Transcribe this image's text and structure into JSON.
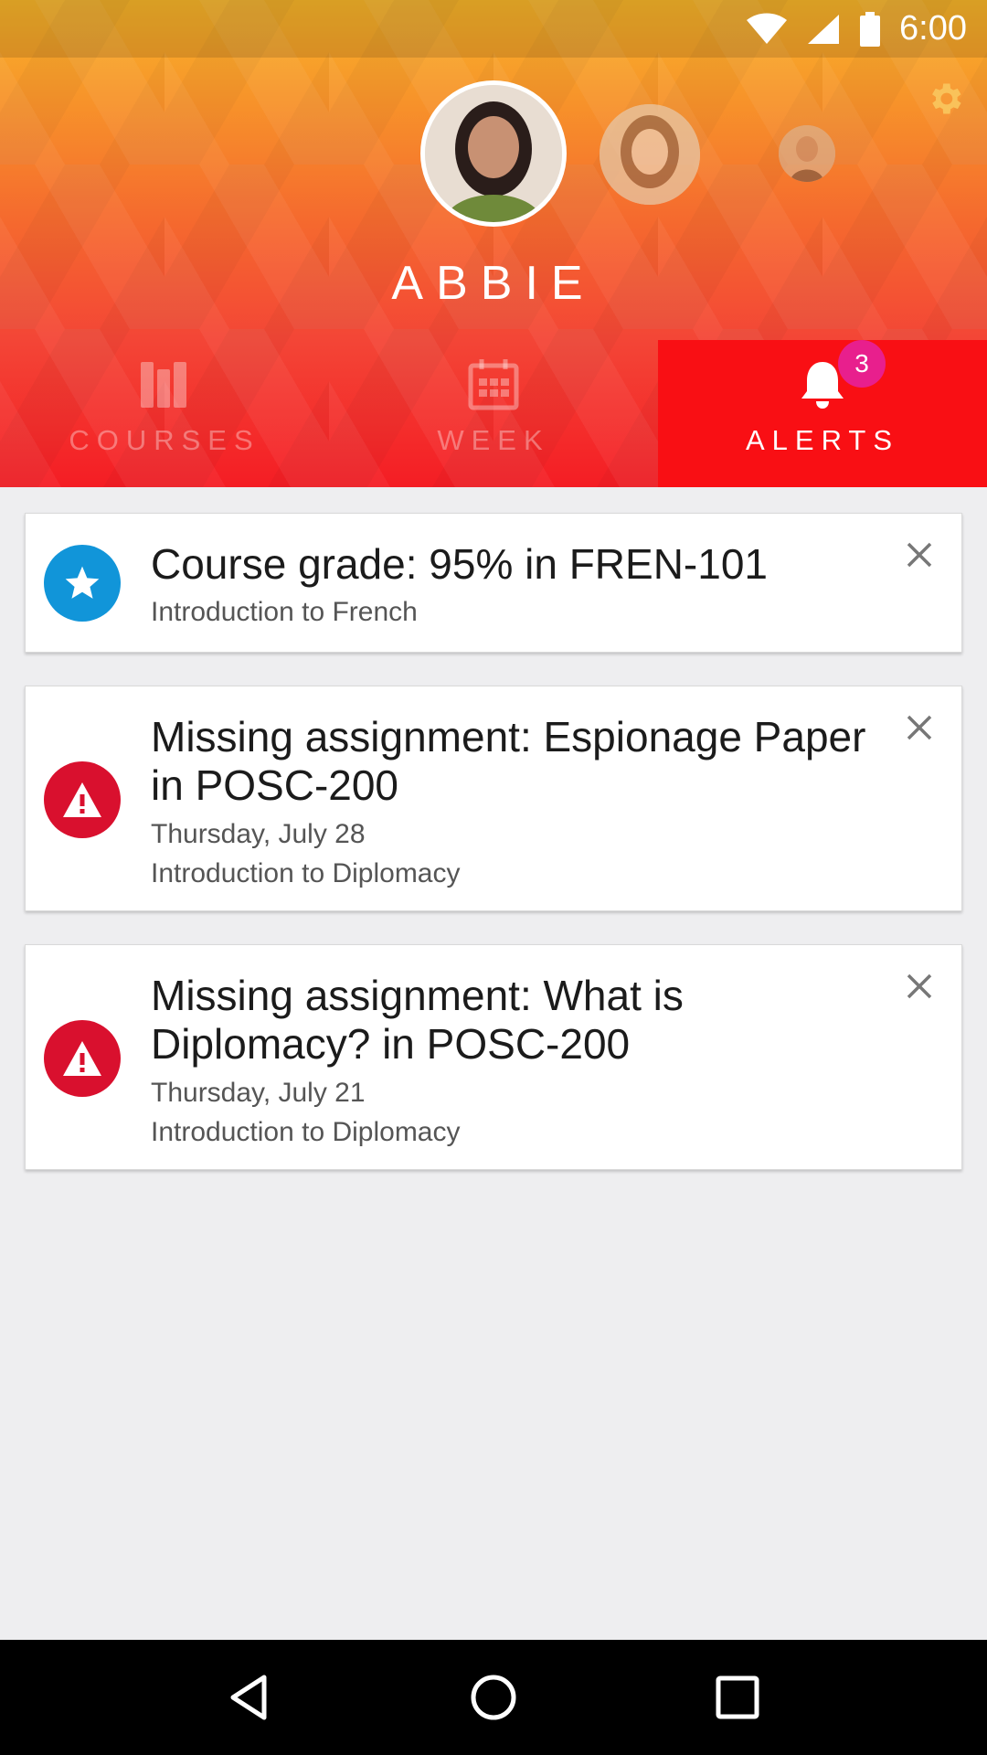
{
  "status_bar": {
    "time": "6:00"
  },
  "profile": {
    "name": "ABBIE"
  },
  "tabs": [
    {
      "label": "COURSES",
      "icon": "courses-icon",
      "active": false
    },
    {
      "label": "WEEK",
      "icon": "calendar-icon",
      "active": false
    },
    {
      "label": "ALERTS",
      "icon": "bell-icon",
      "active": true,
      "badge": "3"
    }
  ],
  "alerts": [
    {
      "icon": "star-icon",
      "title": "Course grade: 95% in FREN-101",
      "subtitle": "Introduction to French"
    },
    {
      "icon": "warning-icon",
      "title": "Missing assignment: Espionage Paper in POSC-200",
      "date": "Thursday, July 28",
      "subtitle": "Introduction to Diplomacy"
    },
    {
      "icon": "warning-icon",
      "title": "Missing assignment: What is Diplomacy? in POSC-200",
      "date": "Thursday, July 21",
      "subtitle": "Introduction to Diplomacy"
    }
  ],
  "colors": {
    "accent_active_tab": "#f90f14",
    "badge": "#e81f8d",
    "star_icon_bg": "#1195d9",
    "warning_icon_bg": "#d9102e"
  }
}
